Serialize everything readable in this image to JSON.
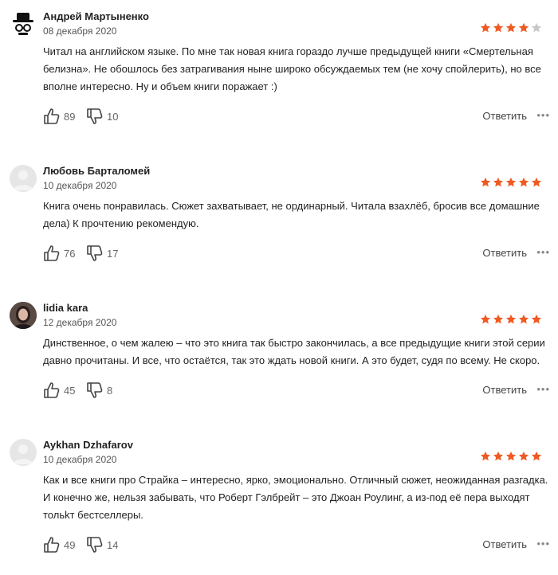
{
  "reviews": [
    {
      "author": "Андрей Мартыненко",
      "date": "08 декабря 2020",
      "rating": 4,
      "max_rating": 5,
      "avatar": "spy-hat-avatar",
      "text": "Читал на английском языке. По мне так новая книга гораздо лучше предыдущей книги «Смертельная белизна». Не обошлось без затрагивания ныне широко обсуждаемых тем (не хочу спойлерить), но все вполне интересно. Ну и объем книги поражает :)",
      "likes": "89",
      "dislikes": "10",
      "reply_label": "Ответить",
      "more_label": "•••"
    },
    {
      "author": "Любовь Барталомей",
      "date": "10 декабря 2020",
      "rating": 5,
      "max_rating": 5,
      "avatar": "default-avatar",
      "text": "Книга очень понравилась. Сюжет захватывает, не ординарный. Читала взахлёб, бросив все домашние дела) К прочтению рекомендую.",
      "likes": "76",
      "dislikes": "17",
      "reply_label": "Ответить",
      "more_label": "•••"
    },
    {
      "author": "lidia kara",
      "date": "12 декабря 2020",
      "rating": 5,
      "max_rating": 5,
      "avatar": "photo-avatar",
      "text": "Динственное, о чем жалею – что это книга так быстро закончилась, а все предыдущие книги этой серии давно прочитаны. И все, что остаётся, так это ждать новой книги. А это будет, судя по всему. Не скоро.",
      "likes": "45",
      "dislikes": "8",
      "reply_label": "Ответить",
      "more_label": "•••"
    },
    {
      "author": "Aykhan Dzhafarov",
      "date": "10 декабря 2020",
      "rating": 5,
      "max_rating": 5,
      "avatar": "default-avatar",
      "text": "Как и все книги про Страйка – интересно, ярко, эмоционально. Отличный сюжет, неожиданная разгадка. И конечно же, нельзя забывать, что Роберт Гэлбрейт – это Джоан Роулинг, а из-под её пера выходят тольkт бестселлеры.",
      "likes": "49",
      "dislikes": "14",
      "reply_label": "Ответить",
      "more_label": "•••"
    }
  ],
  "colors": {
    "star_filled": "#f05a22",
    "star_empty": "#c8c8c8",
    "icon_stroke": "#444444"
  }
}
